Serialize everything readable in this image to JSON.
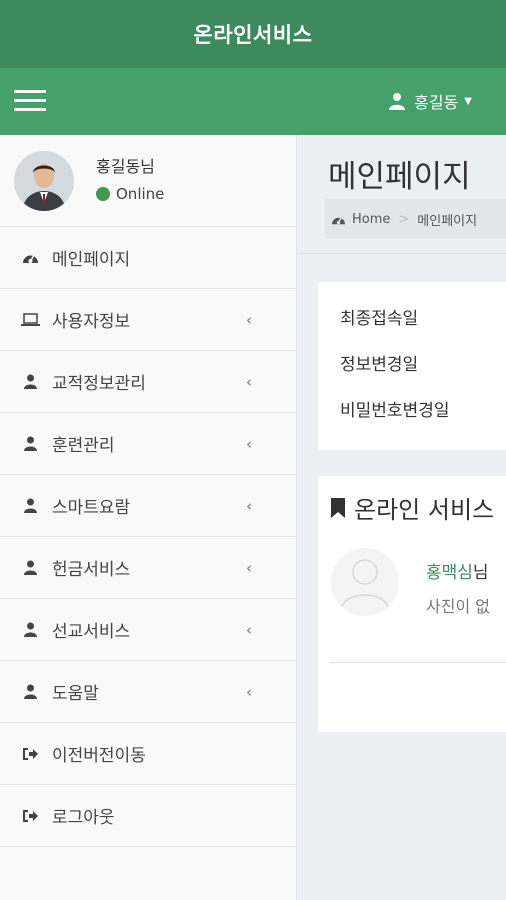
{
  "app": {
    "title": "온라인서비스"
  },
  "navbar": {
    "user_name": "홍길동"
  },
  "sidebar": {
    "profile": {
      "name": "홍길동님",
      "status": "Online"
    },
    "items": [
      {
        "label": "메인페이지",
        "icon": "dashboard-icon",
        "has_submenu": false
      },
      {
        "label": "사용자정보",
        "icon": "laptop-icon",
        "has_submenu": true
      },
      {
        "label": "교적정보관리",
        "icon": "user-icon",
        "has_submenu": true
      },
      {
        "label": "훈련관리",
        "icon": "user-icon",
        "has_submenu": true
      },
      {
        "label": "스마트요람",
        "icon": "user-icon",
        "has_submenu": true
      },
      {
        "label": "헌금서비스",
        "icon": "user-icon",
        "has_submenu": true
      },
      {
        "label": "선교서비스",
        "icon": "user-icon",
        "has_submenu": true
      },
      {
        "label": "도움말",
        "icon": "user-icon",
        "has_submenu": true
      },
      {
        "label": "이전버전이동",
        "icon": "sign-out-icon",
        "has_submenu": false
      },
      {
        "label": "로그아웃",
        "icon": "sign-out-icon",
        "has_submenu": false
      }
    ],
    "chevron": "‹"
  },
  "content": {
    "page_title": "메인페이지",
    "breadcrumb": {
      "home": "Home",
      "separator": ">",
      "current": "메인페이지"
    },
    "info_card": {
      "rows": [
        "최종접속일",
        "정보변경일",
        "비밀번호변경일"
      ]
    },
    "service_card": {
      "title": "온라인 서비스",
      "person_name": "홍맥심",
      "person_suffix": "님",
      "no_photo_text": "사진이 없"
    }
  },
  "colors": {
    "header": "#3d8a5c",
    "navbar": "#46a06a",
    "status_online": "#3e9a4a"
  }
}
